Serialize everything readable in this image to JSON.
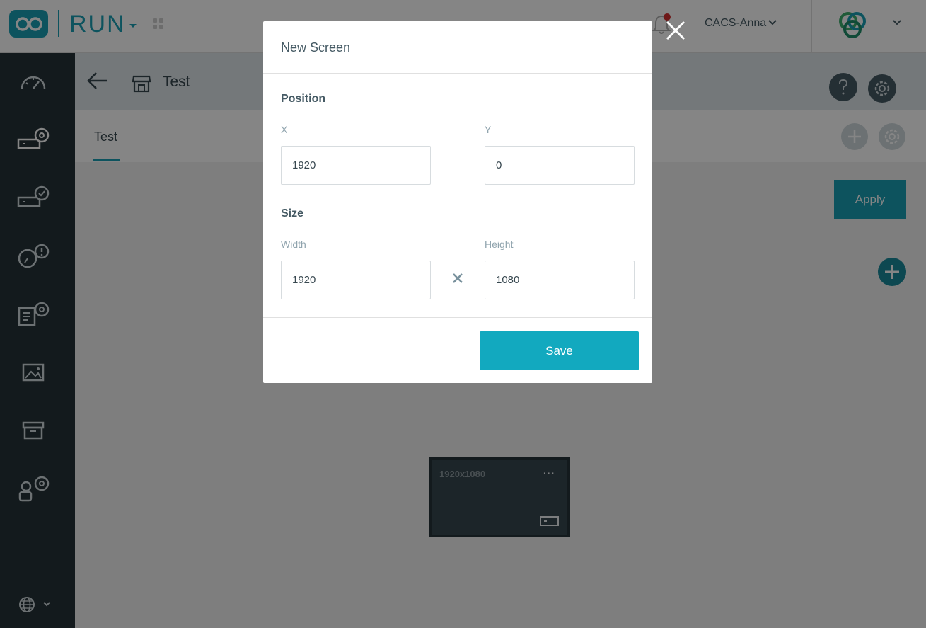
{
  "header": {
    "product_name": "RUN",
    "user_name": "CACS-Anna"
  },
  "page": {
    "title": "Test",
    "tab_label": "Test",
    "apply_label": "Apply"
  },
  "screen_card": {
    "label": "1920x1080",
    "menu_glyph": "···"
  },
  "modal": {
    "title": "New Screen",
    "position_title": "Position",
    "x_label": "X",
    "x_value": "1920",
    "y_label": "Y",
    "y_value": "0",
    "size_title": "Size",
    "width_label": "Width",
    "width_value": "1920",
    "height_label": "Height",
    "height_value": "1080",
    "save_label": "Save"
  },
  "colors": {
    "accent": "#1aa0b4",
    "sidebar": "#263238",
    "save": "#12a9bf"
  },
  "icons": [
    "dashboard-icon",
    "device-settings-icon",
    "device-check-icon",
    "alerts-icon",
    "content-settings-icon",
    "media-icon",
    "archive-icon",
    "user-settings-icon",
    "globe-icon"
  ]
}
